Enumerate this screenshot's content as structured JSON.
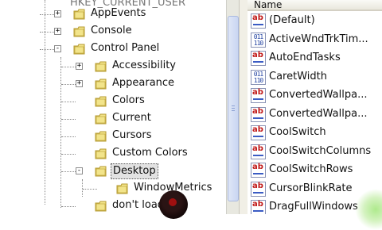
{
  "tree": {
    "partial_root_label": "HKEY_CURRENT_USER",
    "nodes": [
      {
        "label": "AppEvents",
        "expander": "+"
      },
      {
        "label": "Console",
        "expander": "+"
      },
      {
        "label": "Control Panel",
        "expander": "-"
      },
      {
        "label": "Accessibility",
        "expander": "+"
      },
      {
        "label": "Appearance",
        "expander": "+"
      },
      {
        "label": "Colors",
        "expander": ""
      },
      {
        "label": "Current",
        "expander": ""
      },
      {
        "label": "Cursors",
        "expander": ""
      },
      {
        "label": "Custom Colors",
        "expander": ""
      },
      {
        "label": "Desktop",
        "expander": "-"
      },
      {
        "label": "WindowMetrics",
        "expander": ""
      },
      {
        "label": "don't load",
        "expander": ""
      }
    ]
  },
  "values": {
    "column_name": "Name",
    "rows": [
      {
        "name": "(Default)",
        "type": "string",
        "icon_text": "ab"
      },
      {
        "name": "ActiveWndTrkTim...",
        "type": "binary",
        "icon_text": "011\n110"
      },
      {
        "name": "AutoEndTasks",
        "type": "string",
        "icon_text": "ab"
      },
      {
        "name": "CaretWidth",
        "type": "binary",
        "icon_text": "011\n110"
      },
      {
        "name": "ConvertedWallpa...",
        "type": "string",
        "icon_text": "ab"
      },
      {
        "name": "ConvertedWallpa...",
        "type": "string",
        "icon_text": "ab"
      },
      {
        "name": "CoolSwitch",
        "type": "string",
        "icon_text": "ab"
      },
      {
        "name": "CoolSwitchColumns",
        "type": "string",
        "icon_text": "ab"
      },
      {
        "name": "CoolSwitchRows",
        "type": "string",
        "icon_text": "ab"
      },
      {
        "name": "CursorBlinkRate",
        "type": "string",
        "icon_text": "ab"
      },
      {
        "name": "DragFullWindows",
        "type": "string",
        "icon_text": "ab"
      }
    ]
  },
  "colors": {
    "folder_fill": "#f2e48a",
    "folder_stroke": "#b59a2e",
    "selection_bg": "#e2e2e2"
  },
  "icons": [
    "folder-icon",
    "plus-expander-icon",
    "minus-expander-icon",
    "string-value-icon",
    "binary-value-icon"
  ]
}
